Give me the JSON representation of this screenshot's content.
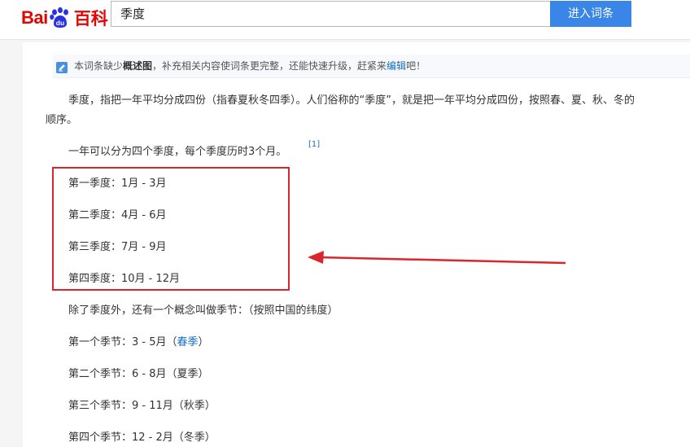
{
  "header": {
    "logo_latin": "Bai",
    "logo_du": "du",
    "logo_cn": "百科",
    "search_value": "季度",
    "search_button": "进入词条"
  },
  "notice": {
    "prefix": "本词条缺少",
    "bold": "概述图",
    "middle": "，补充相关内容使词条更完整，还能快速升级，赶紧来",
    "link": "编辑",
    "suffix": "吧！"
  },
  "content": {
    "para1_line1": "季度，指把一年平均分成四份（指春夏秋冬四季）。人们俗称的“季度”，就是把一年平均分成四份，按照春、夏、秋、冬的",
    "para1_line2": "顺序。",
    "para2": "一年可以分为四个季度，每个季度历时3个月。",
    "ref": "[1]",
    "quarters": [
      "第一季度：1月 - 3月",
      "第二季度：4月 - 6月",
      "第三季度：7月 - 9月",
      "第四季度：10月 - 12月"
    ],
    "season_intro": "除了季度外，还有一个概念叫做季节：（按照中国的纬度）",
    "seasons": [
      {
        "prefix": "第一个季节：3 - 5月（",
        "name": "春季",
        "suffix": "）"
      },
      {
        "prefix": "第二个季节：6 - 8月（",
        "name": "夏季",
        "suffix": "）"
      },
      {
        "prefix": "第三个季节：9 - 11月（",
        "name": "秋季",
        "suffix": "）"
      },
      {
        "prefix": "第四个季节：12 - 2月（",
        "name": "冬季",
        "suffix": "）"
      }
    ]
  },
  "colors": {
    "brand_red": "#e10601",
    "button_blue": "#3a86e8",
    "link_blue": "#136ec2",
    "annotation_red": "#d9262c"
  }
}
